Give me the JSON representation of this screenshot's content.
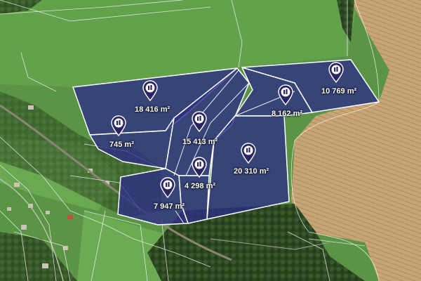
{
  "map": {
    "colors": {
      "meadow": "#5f9a47",
      "forest": "#2f4a22",
      "field": "#c9a878",
      "parcel_fill": "#2c2d86",
      "parcel_border": "#ffffff",
      "pin": "#2a2560"
    },
    "parcels": [
      {
        "id": "p1",
        "area": "18 416 m²"
      },
      {
        "id": "p2",
        "area": "745 m²"
      },
      {
        "id": "p3",
        "area": "15 413 m²"
      },
      {
        "id": "p4",
        "area": "8 162 m²"
      },
      {
        "id": "p5",
        "area": "10 769 m²"
      },
      {
        "id": "p6",
        "area": "20 310 m²"
      },
      {
        "id": "p7",
        "area": "4 298 m²"
      },
      {
        "id": "p8",
        "area": "7 947 m²"
      }
    ],
    "pin_icon": "building-pin-icon"
  }
}
